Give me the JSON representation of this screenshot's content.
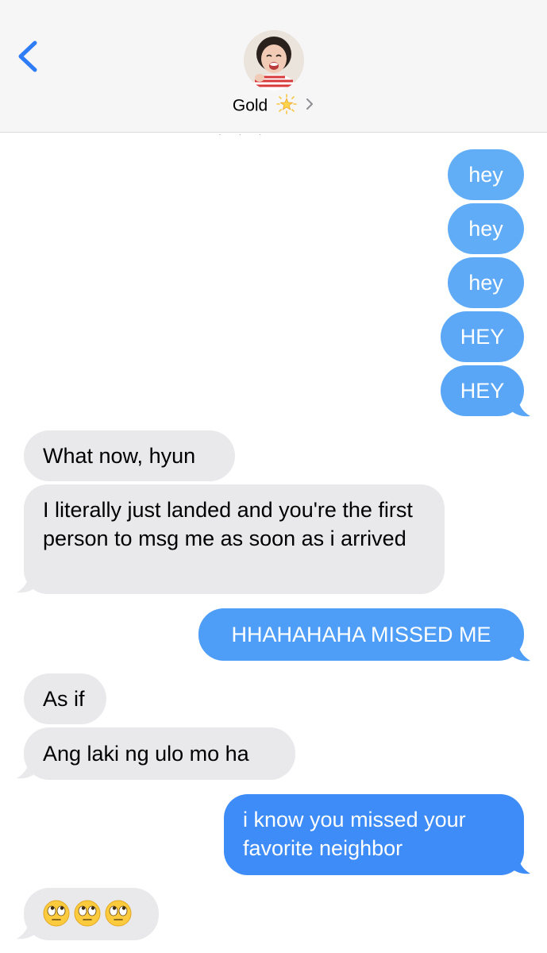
{
  "header": {
    "back_label": "<",
    "contact_name": "Gold",
    "timestamp_fragment": "· ·  ·"
  },
  "colors": {
    "sent_light": "#62acf5",
    "sent_dark": "#3a8bf7",
    "received": "#e9e9eb",
    "accent": "#2f7df6"
  },
  "messages": [
    {
      "side": "sent",
      "text": "hey"
    },
    {
      "side": "sent",
      "text": "hey"
    },
    {
      "side": "sent",
      "text": "hey"
    },
    {
      "side": "sent",
      "text": "HEY"
    },
    {
      "side": "sent",
      "text": "HEY"
    },
    {
      "side": "received",
      "text": "What now, hyun"
    },
    {
      "side": "received",
      "text": "I literally just landed and you're the first person to msg me as soon as i arrived"
    },
    {
      "side": "sent",
      "text": "HHAHAHAHA MISSED ME"
    },
    {
      "side": "received",
      "text": "As if"
    },
    {
      "side": "received",
      "text": "Ang laki ng ulo mo ha"
    },
    {
      "side": "sent",
      "text": "i know you missed your favorite neighbor"
    },
    {
      "side": "received",
      "text": "🙄🙄🙄",
      "icons": [
        "eye-roll-icon",
        "eye-roll-icon",
        "eye-roll-icon"
      ]
    }
  ]
}
